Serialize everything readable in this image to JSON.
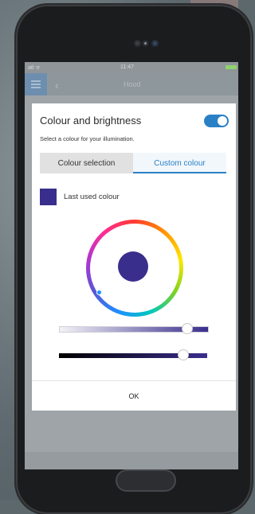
{
  "status": {
    "signal": "atl ᯤ",
    "time": "11:47"
  },
  "appbar": {
    "title": "Hood",
    "back_icon": "chevron-left-icon",
    "menu_icon": "menu-icon"
  },
  "dialog": {
    "title": "Colour and brightness",
    "toggle_on": true,
    "subtitle": "Select a colour for your illumination.",
    "tabs": [
      {
        "label": "Colour selection",
        "active": false
      },
      {
        "label": "Custom colour",
        "active": true
      }
    ],
    "last_used_label": "Last used colour",
    "selected_colour": "#3a2e8d",
    "saturation_level": 0.86,
    "brightness_level": 0.84,
    "ok_label": "OK"
  },
  "colors": {
    "accent": "#2a80c6",
    "selected": "#3a2e8d"
  }
}
